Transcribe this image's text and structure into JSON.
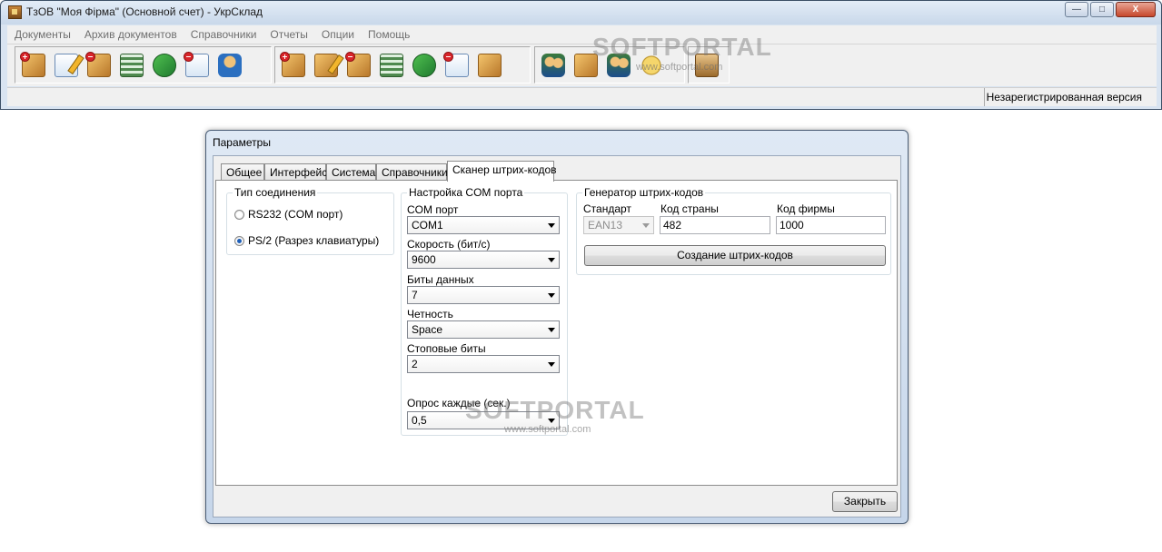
{
  "window": {
    "title": "ТзОВ \"Моя Фірма\" (Основной счет) - УкрСклад",
    "controls": {
      "minimize": "—",
      "maximize": "□",
      "close": "X"
    }
  },
  "menu": [
    "Документы",
    "Архив документов",
    "Справочники",
    "Отчеты",
    "Опции",
    "Помощь"
  ],
  "toolbar": {
    "group1": [
      "add-box-icon",
      "edit-document-icon",
      "delete-box-icon",
      "spreadsheet-icon",
      "transfer-arrows-icon",
      "delete-register-icon",
      "person-document-icon"
    ],
    "group2": [
      "add-box-icon",
      "edit-box-icon",
      "delete-box-icon",
      "calculator-box-icon",
      "transfer-box-icon",
      "register-box-icon",
      "settings-box-icon"
    ],
    "group3": [
      "people-icon",
      "package-icon",
      "exchange-icon",
      "coins-icon"
    ],
    "group4": [
      "clipboard-icon"
    ]
  },
  "status": {
    "registration": "Незарегистрированная версия"
  },
  "watermark": {
    "text": "SOFTPORTAL",
    "sub": "www.softportal.com"
  },
  "dialog": {
    "title": "Параметры",
    "tabs": [
      "Общее",
      "Интерфейс",
      "Система",
      "Справочники",
      "Сканер штрих-кодов"
    ],
    "connection": {
      "label": "Тип соединения",
      "options": [
        "RS232 (COM порт)",
        "PS/2 (Разрез клавиатуры)"
      ],
      "selected_index": 1
    },
    "com": {
      "label": "Настройка COM порта",
      "port_label": "COM порт",
      "port_value": "COM1",
      "speed_label": "Скорость (бит/с)",
      "speed_value": "9600",
      "databits_label": "Биты данных",
      "databits_value": "7",
      "parity_label": "Четность",
      "parity_value": "Space",
      "stopbits_label": "Стоповые биты",
      "stopbits_value": "2",
      "poll_label": "Опрос каждые (сек.)",
      "poll_value": "0,5"
    },
    "generator": {
      "label": "Генератор штрих-кодов",
      "standard_label": "Стандарт",
      "standard_value": "EAN13",
      "country_label": "Код страны",
      "country_value": "482",
      "company_label": "Код фирмы",
      "company_value": "1000",
      "create_button": "Создание  штрих-кодов"
    },
    "close_button": "Закрыть"
  }
}
